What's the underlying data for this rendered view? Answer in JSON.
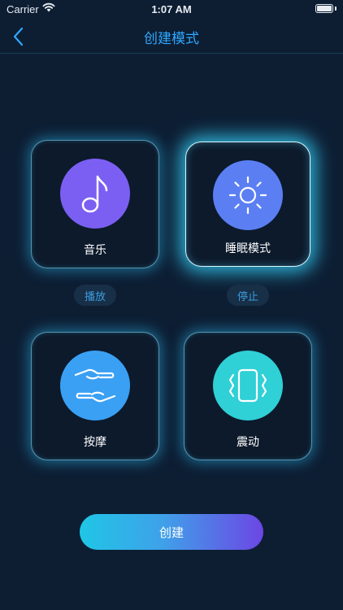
{
  "status_bar": {
    "carrier": "Carrier",
    "time": "1:07 AM"
  },
  "nav": {
    "title": "创建模式"
  },
  "modes": [
    {
      "label": "音乐",
      "icon": "music-note-icon",
      "color": "#7b5ff3",
      "action": "播放"
    },
    {
      "label": "睡眠模式",
      "icon": "sun-icon",
      "color": "#5b7ff3",
      "action": "停止"
    },
    {
      "label": "按摩",
      "icon": "hands-icon",
      "color": "#3aa0f4",
      "action": ""
    },
    {
      "label": "震动",
      "icon": "vibration-icon",
      "color": "#2fd0d6",
      "action": ""
    }
  ],
  "create_button": {
    "label": "创建"
  },
  "colors": {
    "background": "#0d1e33",
    "accent": "#2fa8ff"
  }
}
